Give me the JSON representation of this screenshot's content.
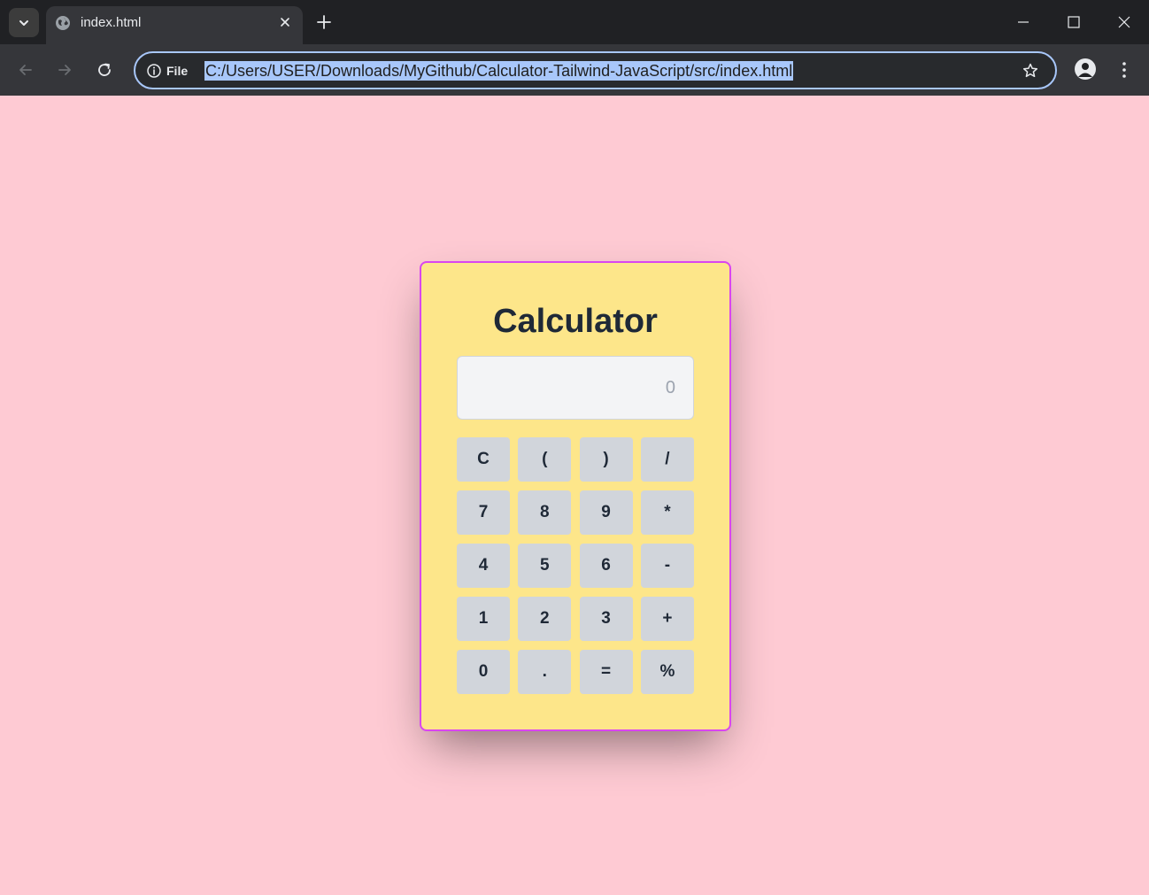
{
  "browser": {
    "tab": {
      "title": "index.html"
    },
    "address_bar": {
      "scheme_label": "File",
      "url": "C:/Users/USER/Downloads/MyGithub/Calculator-Tailwind-JavaScript/src/index.html"
    }
  },
  "calculator": {
    "title": "Calculator",
    "display": {
      "value": "",
      "placeholder": "0"
    },
    "keys": [
      "C",
      "(",
      ")",
      "/",
      "7",
      "8",
      "9",
      "*",
      "4",
      "5",
      "6",
      "-",
      "1",
      "2",
      "3",
      "+",
      "0",
      ".",
      "=",
      "%"
    ]
  },
  "colors": {
    "page_background": "#fecad3",
    "calculator_background": "#fde68a",
    "calculator_border": "#d946ef",
    "key_background": "#d1d5db",
    "display_background": "#f3f4f6",
    "url_selection": "#a8c7fa"
  }
}
